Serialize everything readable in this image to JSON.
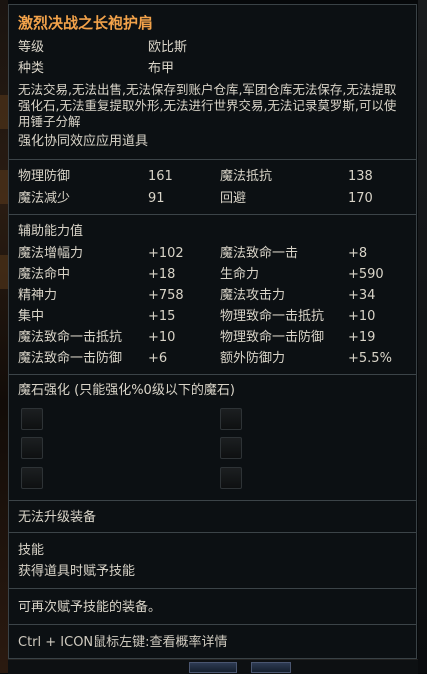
{
  "item": {
    "name": "激烈决战之长袍护肩",
    "level_label": "等级",
    "level_value": "欧比斯",
    "type_label": "种类",
    "type_value": "布甲",
    "restrictions": "无法交易,无法出售,无法保存到账户仓库,军团仓库无法保存,无法提取强化石,无法重复提取外形,无法进行世界交易,无法记录莫罗斯,可以使用锤子分解",
    "set_effect": "强化协同效应应用道具"
  },
  "base_stats": [
    {
      "label": "物理防御",
      "value": "161",
      "label2": "魔法抵抗",
      "value2": "138"
    },
    {
      "label": "魔法减少",
      "value": "91",
      "label2": "回避",
      "value2": "170"
    }
  ],
  "bonus": {
    "header": "辅助能力值",
    "rows": [
      {
        "label": "魔法增幅力",
        "value": "+102",
        "label2": "魔法致命一击",
        "value2": "+8"
      },
      {
        "label": "魔法命中",
        "value": "+18",
        "label2": "生命力",
        "value2": "+590"
      },
      {
        "label": "精神力",
        "value": "+758",
        "label2": "魔法攻击力",
        "value2": "+34"
      },
      {
        "label": "集中",
        "value": "+15",
        "label2": "物理致命一击抵抗",
        "value2": "+10"
      },
      {
        "label": "魔法致命一击抵抗",
        "value": "+10",
        "label2": "物理致命一击防御",
        "value2": "+19"
      },
      {
        "label": "魔法致命一击防御",
        "value": "+6",
        "label2": "额外防御力",
        "value2": "+5.5%"
      }
    ]
  },
  "manastone": {
    "header": "魔石强化 (只能强化%0级以下的魔石)",
    "slot_count": 6
  },
  "upgrade": "无法升级装备",
  "skill": {
    "header": "技能",
    "text": "获得道具时赋予技能"
  },
  "reenchant": "可再次赋予技能的装备。",
  "hint": "Ctrl + ICON鼠标左键:查看概率详情"
}
